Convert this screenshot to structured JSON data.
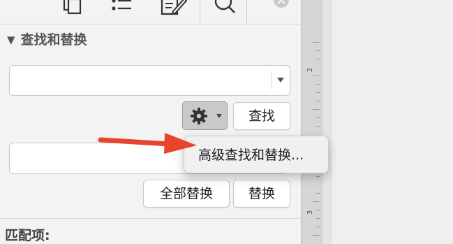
{
  "panel": {
    "section_title": "查找和替换",
    "find_button": "查找",
    "replace_all_button": "全部替换",
    "replace_button": "替换",
    "matches_label": "匹配项:",
    "find_value": "",
    "replace_value": ""
  },
  "popup_menu": {
    "items": [
      "高级查找和替换..."
    ]
  },
  "ruler": {
    "labels": [
      "2",
      "3"
    ]
  },
  "tabs": [
    "copy-icon",
    "list-icon",
    "edit-icon",
    "search-icon",
    "close-icon"
  ],
  "colors": {
    "annotation_arrow": "#e8432b",
    "sidebar_bg": "#f3f3f3",
    "gear_button_bg": "#c9c9c9"
  }
}
